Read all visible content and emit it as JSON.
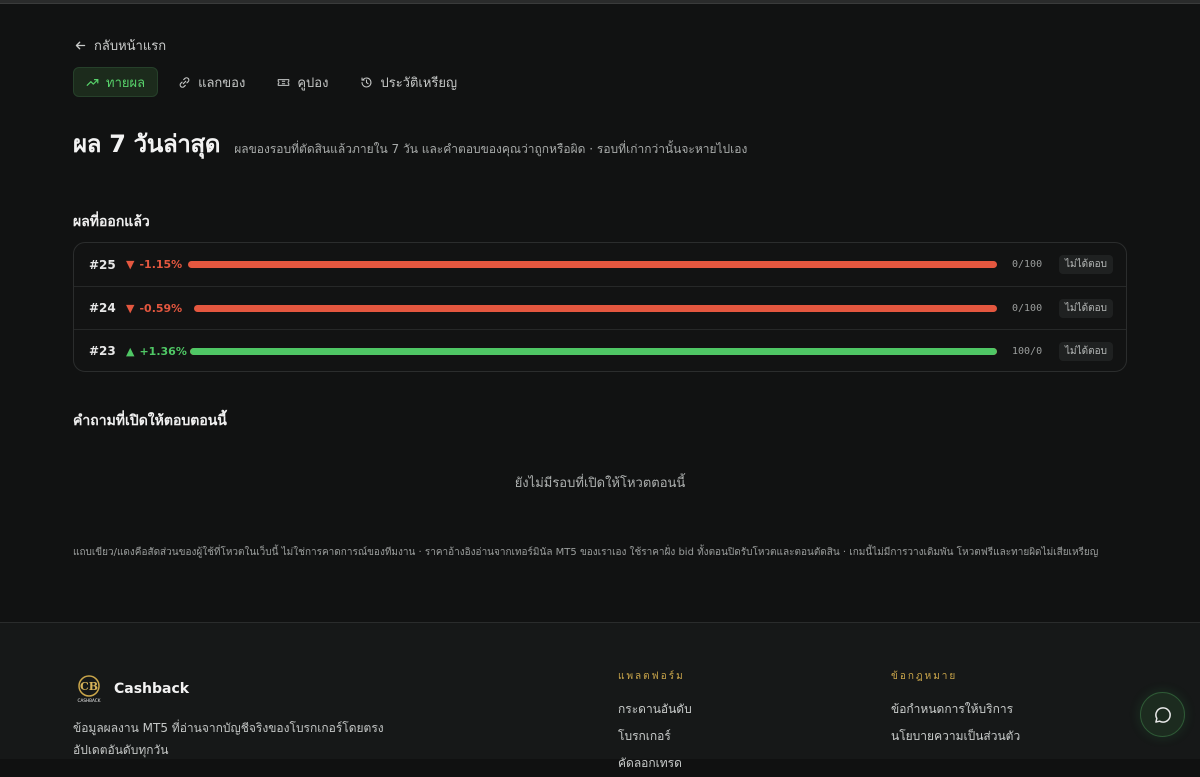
{
  "nav": {
    "back_label": "กลับหน้าแรก"
  },
  "tabs": [
    {
      "label": "ทายผล",
      "icon": "trending-up-icon",
      "active": true
    },
    {
      "label": "แลกของ",
      "icon": "link-icon",
      "active": false
    },
    {
      "label": "คูปอง",
      "icon": "ticket-icon",
      "active": false
    },
    {
      "label": "ประวัติเหรียญ",
      "icon": "history-icon",
      "active": false
    }
  ],
  "header": {
    "title": "ผล 7 วันล่าสุด",
    "subtitle": "ผลของรอบที่ตัดสินแล้วภายใน 7 วัน และคำตอบของคุณว่าถูกหรือผิด · รอบที่เก่ากว่านั้นจะหายไปเอง"
  },
  "results": {
    "heading": "ผลที่ออกแล้ว",
    "rows": [
      {
        "id": "#25",
        "direction": "down",
        "arrow": "▼",
        "change": "-1.15%",
        "green_pct": 0,
        "votes": "0/100",
        "status": "ไม่ได้ตอบ"
      },
      {
        "id": "#24",
        "direction": "down",
        "arrow": "▼",
        "change": "-0.59%",
        "green_pct": 0,
        "votes": "0/100",
        "status": "ไม่ได้ตอบ"
      },
      {
        "id": "#23",
        "direction": "up",
        "arrow": "▲",
        "change": "+1.36%",
        "green_pct": 100,
        "votes": "100/0",
        "status": "ไม่ได้ตอบ"
      }
    ]
  },
  "open_questions": {
    "heading": "คำถามที่เปิดให้ตอบตอนนี้",
    "empty_text": "ยังไม่มีรอบที่เปิดให้โหวตตอนนี้"
  },
  "note": "แถบเขียว/แดงคือสัดส่วนของผู้ใช้ที่โหวตในเว็บนี้ ไม่ใช่การคาดการณ์ของทีมงาน · ราคาอ้างอิงอ่านจากเทอร์มินัล MT5 ของเราเอง ใช้ราคาฝั่ง bid ทั้งตอนปิดรับโหวตและตอนตัดสิน · เกมนี้ไม่มีการวางเดิมพัน โหวตฟรีและทายผิดไม่เสียเหรียญ",
  "footer": {
    "brand": "Cashback",
    "logo_text": "CASHBACK",
    "about_line1": "ข้อมูลผลงาน MT5 ที่อ่านจากบัญชีจริงของโบรกเกอร์โดยตรง",
    "about_line2": "อัปเดตอันดับทุกวัน",
    "platform": {
      "heading": "แพลตฟอร์ม",
      "links": [
        "กระดานอันดับ",
        "โบรกเกอร์",
        "คัดลอกเทรด"
      ]
    },
    "legal": {
      "heading": "ข้อกฎหมาย",
      "links": [
        "ข้อกำหนดการให้บริการ",
        "นโยบายความเป็นส่วนตัว"
      ]
    }
  },
  "colors": {
    "accent_green": "#4fc765",
    "down_red": "#e4573f",
    "gold": "#c9a54a"
  }
}
